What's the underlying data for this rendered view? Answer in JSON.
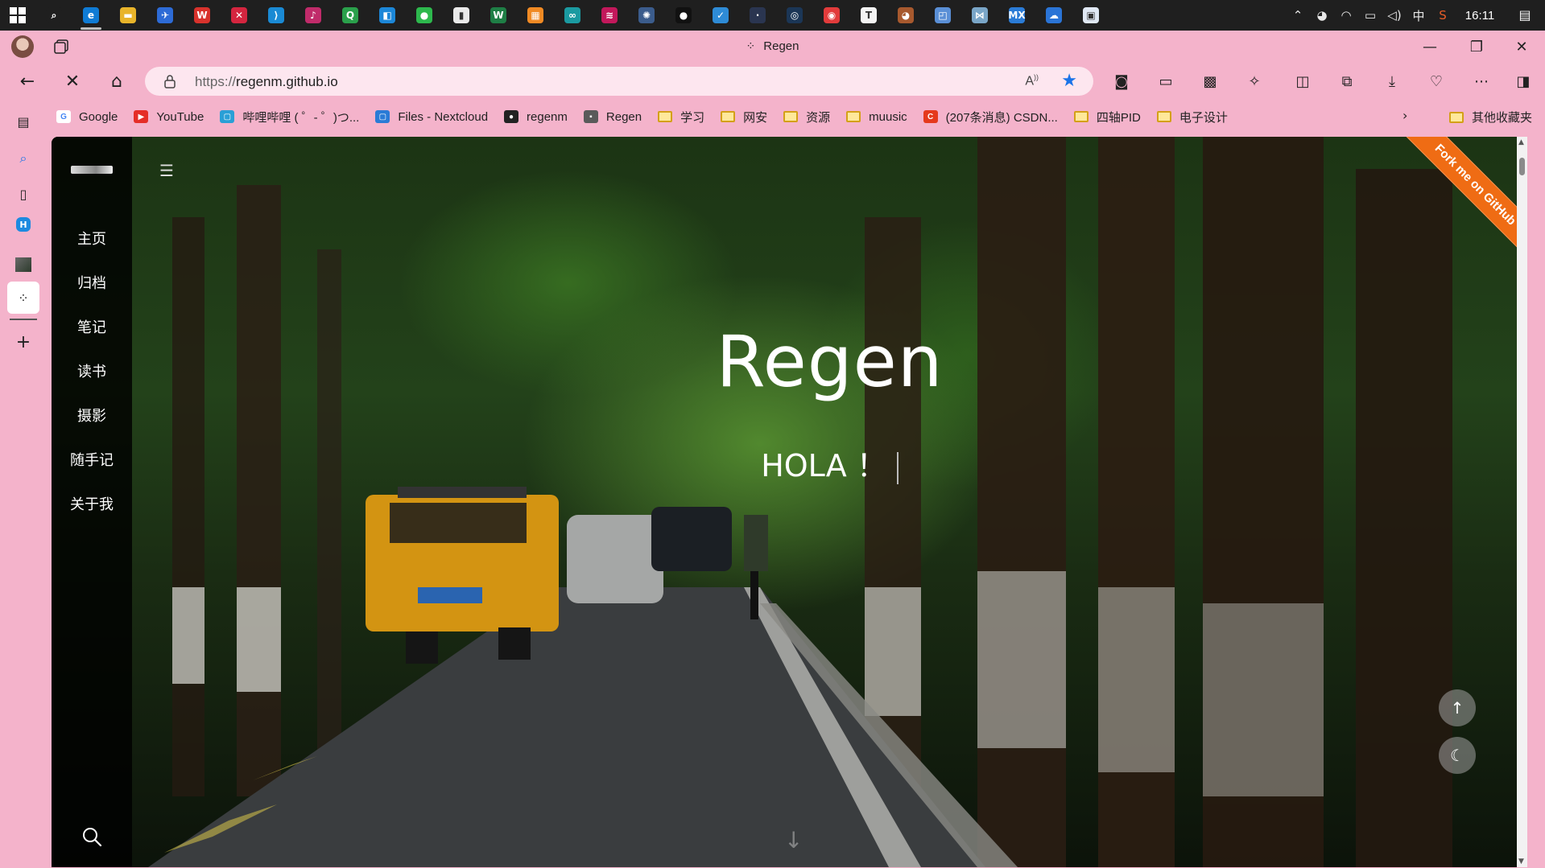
{
  "taskbar": {
    "apps": [
      {
        "icon": "search-icon",
        "glyph": "⌕",
        "color": "#1f1f1f"
      },
      {
        "icon": "edge-icon",
        "glyph": "e",
        "color": "#0f7bd4",
        "active": true
      },
      {
        "icon": "file-explorer-icon",
        "glyph": "▬",
        "color": "#e8b42a"
      },
      {
        "icon": "app-blue-icon",
        "glyph": "✈",
        "color": "#2d6bd6"
      },
      {
        "icon": "wps-icon",
        "glyph": "W",
        "color": "#d8322c"
      },
      {
        "icon": "xmind-icon",
        "glyph": "✕",
        "color": "#d4253f"
      },
      {
        "icon": "vscode-icon",
        "glyph": "⟩",
        "color": "#1a8ad4"
      },
      {
        "icon": "app-pink-icon",
        "glyph": "♪",
        "color": "#c02b6a"
      },
      {
        "icon": "app-green-icon",
        "glyph": "Q",
        "color": "#2aa04b"
      },
      {
        "icon": "app-orange-icon",
        "glyph": "◧",
        "color": "#1c87d8"
      },
      {
        "icon": "wechat-icon",
        "glyph": "●",
        "color": "#2db84d"
      },
      {
        "icon": "notepad-icon",
        "glyph": "▮",
        "color": "#eaeaea"
      },
      {
        "icon": "excel-icon",
        "glyph": "W",
        "color": "#1e7e45"
      },
      {
        "icon": "app-grid-icon",
        "glyph": "▦",
        "color": "#f08a24"
      },
      {
        "icon": "arduino-icon",
        "glyph": "∞",
        "color": "#1b9aa1"
      },
      {
        "icon": "app-rss-icon",
        "glyph": "≋",
        "color": "#c2185b"
      },
      {
        "icon": "app-robot-icon",
        "glyph": "✺",
        "color": "#3b5c8c"
      },
      {
        "icon": "qq-icon",
        "glyph": "●",
        "color": "#111111"
      },
      {
        "icon": "app-check-icon",
        "glyph": "✓",
        "color": "#2e8bd6"
      },
      {
        "icon": "app-dark-icon",
        "glyph": "·",
        "color": "#2a3550"
      },
      {
        "icon": "steam-icon",
        "glyph": "◎",
        "color": "#1b3656"
      },
      {
        "icon": "netease-icon",
        "glyph": "◉",
        "color": "#e23b3b"
      },
      {
        "icon": "typora-icon",
        "glyph": "T",
        "color": "#f4f4f4"
      },
      {
        "icon": "app-bear-icon",
        "glyph": "◕",
        "color": "#a7592e"
      },
      {
        "icon": "app-window-icon",
        "glyph": "◰",
        "color": "#5a8fd6"
      },
      {
        "icon": "app-butterfly-icon",
        "glyph": "⋈",
        "color": "#7aa6c8"
      },
      {
        "icon": "mx-icon",
        "glyph": "MX",
        "color": "#2a7bd6"
      },
      {
        "icon": "onedrive-icon",
        "glyph": "☁",
        "color": "#2a74d6"
      },
      {
        "icon": "app-screen-icon",
        "glyph": "▣",
        "color": "#e0e8f4"
      }
    ],
    "tray": {
      "chevron": "⌃",
      "ime": "中",
      "clock": "16:11"
    }
  },
  "browser": {
    "window_title": "Regen",
    "url_proto": "https://",
    "url_host": "regenm.github.io",
    "bookmarks": [
      {
        "icon": "google-icon",
        "label": "Google",
        "color": "#ffffff",
        "glyph": "G"
      },
      {
        "icon": "youtube-icon",
        "label": "YouTube",
        "color": "#e52d27",
        "glyph": "▶"
      },
      {
        "icon": "bilibili-icon",
        "label": "哔哩哔哩 ( ゜- ゜)つ...",
        "color": "#2a9fd6",
        "glyph": "▢"
      },
      {
        "icon": "nextcloud-icon",
        "label": "Files - Nextcloud",
        "color": "#2a7bd6",
        "glyph": "▢"
      },
      {
        "icon": "github-icon",
        "label": "regenm",
        "color": "#222222",
        "glyph": "●"
      },
      {
        "icon": "regen-icon",
        "label": "Regen",
        "color": "#5a5a5a",
        "glyph": "▪"
      },
      {
        "icon": "folder-icon",
        "label": "学习",
        "folder": true
      },
      {
        "icon": "folder-icon",
        "label": "网安",
        "folder": true
      },
      {
        "icon": "folder-icon",
        "label": "资源",
        "folder": true
      },
      {
        "icon": "folder-icon",
        "label": "muusic",
        "folder": true
      },
      {
        "icon": "csdn-icon",
        "label": "(207条消息) CSDN...",
        "color": "#e5391c",
        "glyph": "C"
      },
      {
        "icon": "folder-icon",
        "label": "四轴PID",
        "folder": true
      },
      {
        "icon": "folder-icon",
        "label": "电子设计",
        "folder": true
      }
    ],
    "other_bookmarks": "其他收藏夹"
  },
  "page": {
    "nav": [
      "主页",
      "归档",
      "笔记",
      "读书",
      "摄影",
      "随手记",
      "关于我"
    ],
    "title": "Regen",
    "subtitle": "HOLA ！",
    "fork_ribbon": "Fork me on GitHub"
  }
}
